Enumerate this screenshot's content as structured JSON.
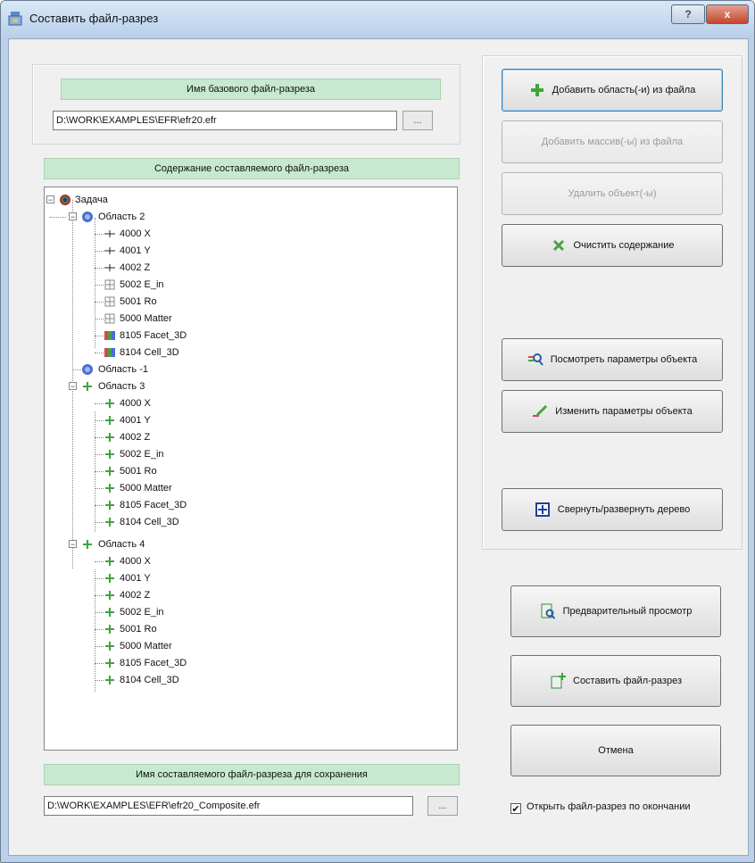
{
  "window": {
    "title": "Составить файл-разрез",
    "help_label": "?",
    "close_label": "x"
  },
  "base_file": {
    "label": "Имя базового файл-разреза",
    "path": "D:\\WORK\\EXAMPLES\\EFR\\efr20.efr",
    "browse_label": "..."
  },
  "content": {
    "label": "Содержание составляемого файл-разреза",
    "tree": {
      "root": "Задача",
      "area2": "Область 2",
      "area2_items": [
        "4000 X",
        "4001 Y",
        "4002 Z",
        "5002 E_in",
        "5001 Ro",
        "5000 Matter",
        "8105 Facet_3D",
        "8104 Cell_3D"
      ],
      "area_minus1": "Область -1",
      "area3": "Область 3",
      "area3_items": [
        "4000 X",
        "4001 Y",
        "4002 Z",
        "5002 E_in",
        "5001 Ro",
        "5000 Matter",
        "8105 Facet_3D",
        "8104 Cell_3D"
      ],
      "area4": "Область 4",
      "area4_items": [
        "4000 X",
        "4001 Y",
        "4002 Z",
        "5002 E_in",
        "5001 Ro",
        "5000 Matter",
        "8105 Facet_3D",
        "8104 Cell_3D"
      ],
      "expander_minus": "−"
    }
  },
  "save_file": {
    "label": "Имя составляемого файл-разреза для сохранения",
    "path": "D:\\WORK\\EXAMPLES\\EFR\\efr20_Composite.efr",
    "browse_label": "..."
  },
  "buttons": {
    "add_areas": "Добавить область(-и) из файла",
    "add_arrays": "Добавить массив(-ы) из файла",
    "delete_objects": "Удалить объект(-ы)",
    "clear_content": "Очистить содержание",
    "view_params": "Посмотреть параметры объекта",
    "edit_params": "Изменить  параметры объекта",
    "toggle_tree": "Свернуть/развернуть дерево",
    "preview": "Предварительный просмотр",
    "compose": "Составить файл-разрез",
    "cancel": "Отмена"
  },
  "open_after": {
    "label": "Открыть файл-разрез по окончании",
    "checked_mark": "✔"
  },
  "colors": {
    "green_label_bg": "#c7e9cf",
    "accent_green": "#3ea53a",
    "title_bar": "#c8dcf1"
  }
}
